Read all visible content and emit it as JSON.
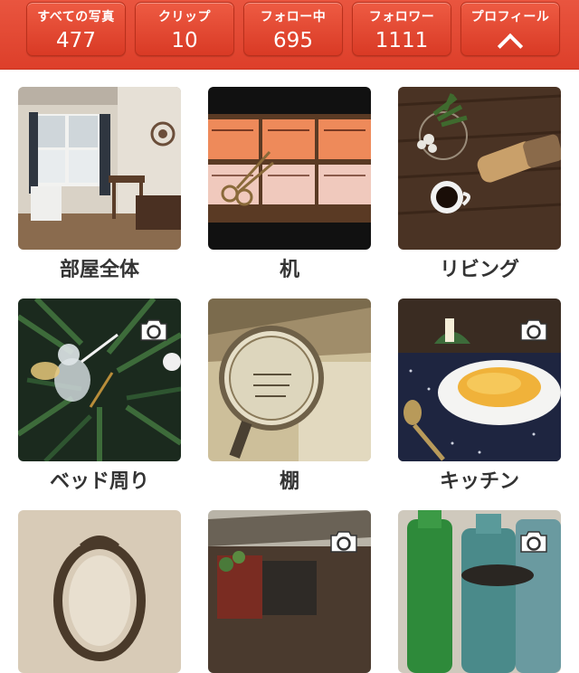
{
  "header": {
    "stats": [
      {
        "label": "すべての写真",
        "value": "477"
      },
      {
        "label": "クリップ",
        "value": "10"
      },
      {
        "label": "フォロー中",
        "value": "695"
      },
      {
        "label": "フォロワー",
        "value": "1111"
      }
    ],
    "profile_label": "プロフィール",
    "profile_icon": "chevron-up-icon",
    "accent_color": "#e04a33"
  },
  "grid": {
    "items": [
      {
        "label": "部屋全体",
        "icon": null
      },
      {
        "label": "机",
        "icon": null
      },
      {
        "label": "リビング",
        "icon": null
      },
      {
        "label": "ベッド周り",
        "icon": "camera-icon"
      },
      {
        "label": "棚",
        "icon": null
      },
      {
        "label": "キッチン",
        "icon": "camera-icon"
      },
      {
        "label": "",
        "icon": null
      },
      {
        "label": "",
        "icon": "camera-icon"
      },
      {
        "label": "",
        "icon": "camera-icon"
      }
    ]
  }
}
